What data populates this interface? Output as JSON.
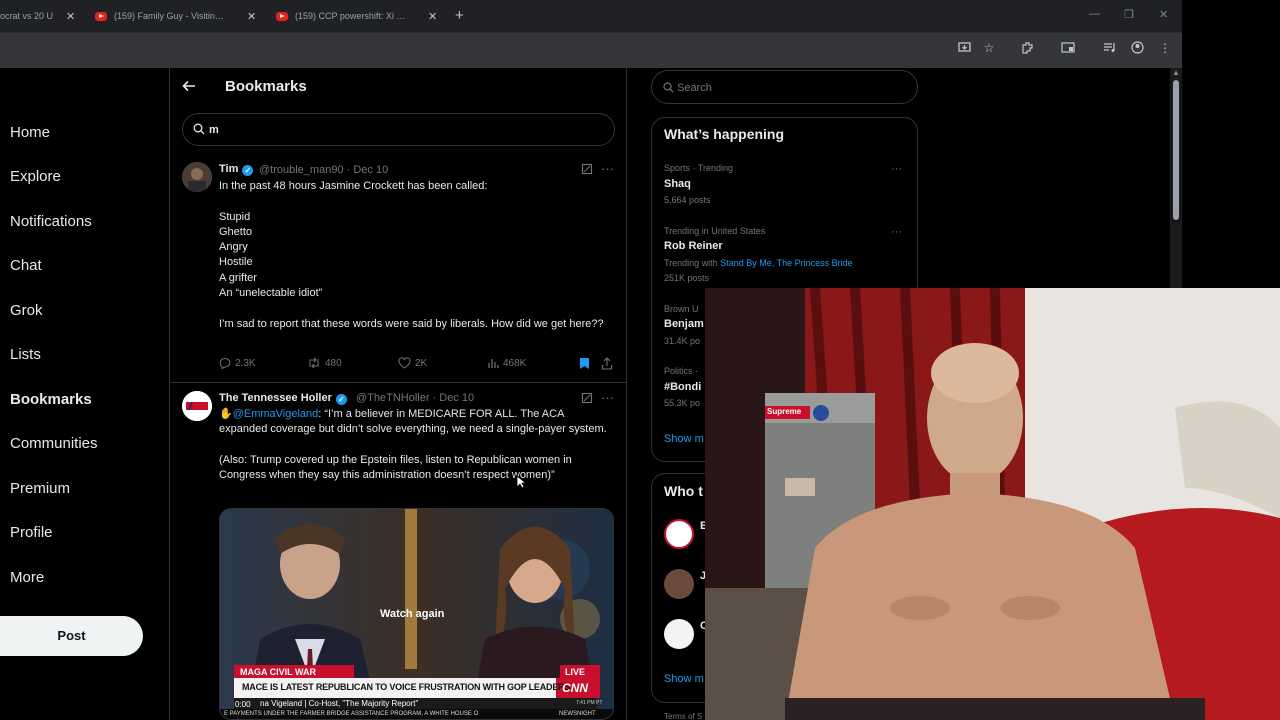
{
  "browser": {
    "tabs": [
      {
        "title": "ocrat vs 20 U"
      },
      {
        "title": "(159) Family Guy - Visiting Gro"
      },
      {
        "title": "(159) CCP powershift: Xi missin"
      }
    ]
  },
  "sidebar": {
    "items": [
      {
        "label": "Home"
      },
      {
        "label": "Explore"
      },
      {
        "label": "Notifications"
      },
      {
        "label": "Chat"
      },
      {
        "label": "Grok"
      },
      {
        "label": "Lists"
      },
      {
        "label": "Bookmarks"
      },
      {
        "label": "Communities"
      },
      {
        "label": "Premium"
      },
      {
        "label": "Profile"
      },
      {
        "label": "More"
      }
    ],
    "post_label": "Post"
  },
  "main": {
    "title": "Bookmarks",
    "search_value": "m",
    "tweets": [
      {
        "name": "Tim",
        "handle": "@trouble_man90 · Dec 10",
        "lines": [
          "In the past 48 hours Jasmine Crockett has been called:",
          "",
          "Stupid",
          "Ghetto",
          "Angry",
          "Hostile",
          "A grifter",
          "An “unelectable idiot”",
          "",
          "I’m sad to report that these words were said by liberals. How did we get here??"
        ],
        "replies": "2.3K",
        "reposts": "480",
        "likes": "2K",
        "views": "468K"
      },
      {
        "name": "The Tennessee Holler",
        "handle": "@TheTNHoller · Dec 10",
        "mention": "@EmmaVigeland",
        "text_after_mention": ": “I’m a believer in MEDICARE FOR ALL. The ACA expanded coverage but didn’t solve everything, we need a single-payer system.",
        "text_para2": "(Also: Trump covered up the Epstein files, listen to Republican women in Congress when they say this administration doesn’t respect women)”",
        "video": {
          "watch_again": "Watch again",
          "banner_tag": "MAGA CIVIL WAR",
          "live": "LIVE",
          "headline": "MACE IS LATEST REPUBLICAN TO VOICE FRUSTRATION WITH GOP LEADERS",
          "guest": "na Vigeland | Co-Host, \"The Majority Report\"",
          "time": "0:00",
          "network": "CNN",
          "ticker": "E PAYMENTS UNDER THE FARMER BRIDGE ASSISTANCE PROGRAM, A WHITE HOUSE O",
          "newsnight": "NEWSNIGHT",
          "clock": "7:41 PM PT"
        }
      }
    ]
  },
  "right": {
    "search_placeholder": "Search",
    "whats_happening_title": "What’s happening",
    "trends": [
      {
        "meta": "Sports · Trending",
        "name": "Shaq",
        "posts": "5,664 posts"
      },
      {
        "meta": "Trending in United States",
        "name": "Rob Reiner",
        "with_prefix": "Trending with ",
        "with_links": "Stand By Me, The Princess Bride",
        "posts": "251K posts"
      },
      {
        "meta": "Brown U",
        "name": "Benjam",
        "posts": "31.4K po"
      },
      {
        "meta": "Politics ·",
        "name": "#Bondi",
        "posts": "55.3K po"
      }
    ],
    "show_more": "Show m",
    "who_to_follow_title": "Who t",
    "follow_initials": [
      "E",
      "J",
      "C"
    ],
    "show_more_2": "Show m",
    "footer": "Terms of S"
  },
  "overlay": {
    "supreme_label": "Supreme"
  },
  "colors": {
    "accent": "#1d9bf0",
    "bookmark_active": "#1d9bf0",
    "background": "#000000"
  }
}
